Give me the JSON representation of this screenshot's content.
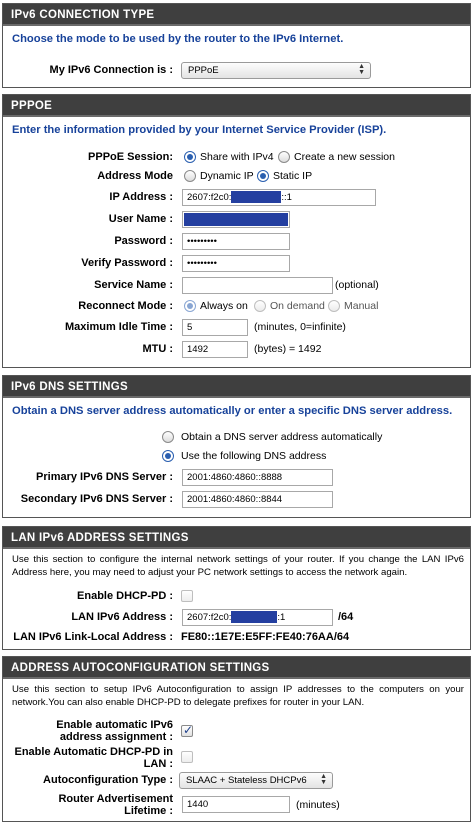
{
  "ipv6_connection_type": {
    "header": "IPv6 CONNECTION TYPE",
    "description": "Choose the mode to be used by the router to the IPv6 Internet.",
    "label": "My IPv6 Connection is :",
    "selected": "PPPoE"
  },
  "pppoe": {
    "header": "PPPOE",
    "description": "Enter the information provided by your Internet Service Provider (ISP).",
    "session_label": "PPPoE Session:",
    "session_options": [
      "Share with IPv4",
      "Create a new session"
    ],
    "address_mode_label": "Address Mode",
    "address_mode_options": [
      "Dynamic IP",
      "Static IP"
    ],
    "ip_label": "IP Address :",
    "ip_prefix": "2607:f2c0:",
    "ip_suffix": "::1",
    "username_label": "User Name :",
    "password_label": "Password :",
    "password_value": "•••••••••",
    "verify_label": "Verify Password :",
    "verify_value": "•••••••••",
    "service_label": "Service Name :",
    "service_value": "",
    "service_note": "(optional)",
    "reconnect_label": "Reconnect Mode :",
    "reconnect_options": [
      "Always on",
      "On demand",
      "Manual"
    ],
    "idle_label": "Maximum Idle Time :",
    "idle_value": "5",
    "idle_note": "(minutes, 0=infinite)",
    "mtu_label": "MTU :",
    "mtu_value": "1492",
    "mtu_note": "(bytes) = 1492"
  },
  "dns": {
    "header": "IPv6 DNS SETTINGS",
    "description": "Obtain a DNS server address automatically or enter a specific DNS server address.",
    "option_auto": "Obtain a DNS server address automatically",
    "option_manual": "Use the following DNS address",
    "primary_label": "Primary IPv6 DNS Server :",
    "primary_value": "2001:4860:4860::8888",
    "secondary_label": "Secondary IPv6 DNS Server :",
    "secondary_value": "2001:4860:4860::8844"
  },
  "lan": {
    "header": "LAN IPv6 ADDRESS SETTINGS",
    "description": "Use this section to configure the internal network settings of your router. If you change the LAN IPv6 Address here, you may need to adjust your PC network settings to access the network again.",
    "dhcp_pd_label": "Enable DHCP-PD :",
    "lan_address_label": "LAN IPv6 Address :",
    "lan_prefix": "2607:f2c0:",
    "lan_suffix": ":1",
    "lan_prefix_len": "/64",
    "link_local_label": "LAN IPv6 Link-Local Address :",
    "link_local_value": "FE80::1E7E:E5FF:FE40:76AA/64"
  },
  "autoconf": {
    "header": "ADDRESS AUTOCONFIGURATION SETTINGS",
    "description": "Use this section to setup IPv6 Autoconfiguration to assign IP addresses to the computers on your network.You can also enable DHCP-PD to delegate prefixes for router in your LAN.",
    "enable_auto_label_1": "Enable automatic IPv6",
    "enable_auto_label_2": "address assignment :",
    "enable_pd_label_1": "Enable Automatic DHCP-PD in",
    "enable_pd_label_2": "LAN :",
    "type_label": "Autoconfiguration Type :",
    "type_selected": "SLAAC + Stateless DHCPv6",
    "lifetime_label_1": "Router Advertisement",
    "lifetime_label_2": "Lifetime :",
    "lifetime_value": "1440",
    "lifetime_note": "(minutes)"
  }
}
